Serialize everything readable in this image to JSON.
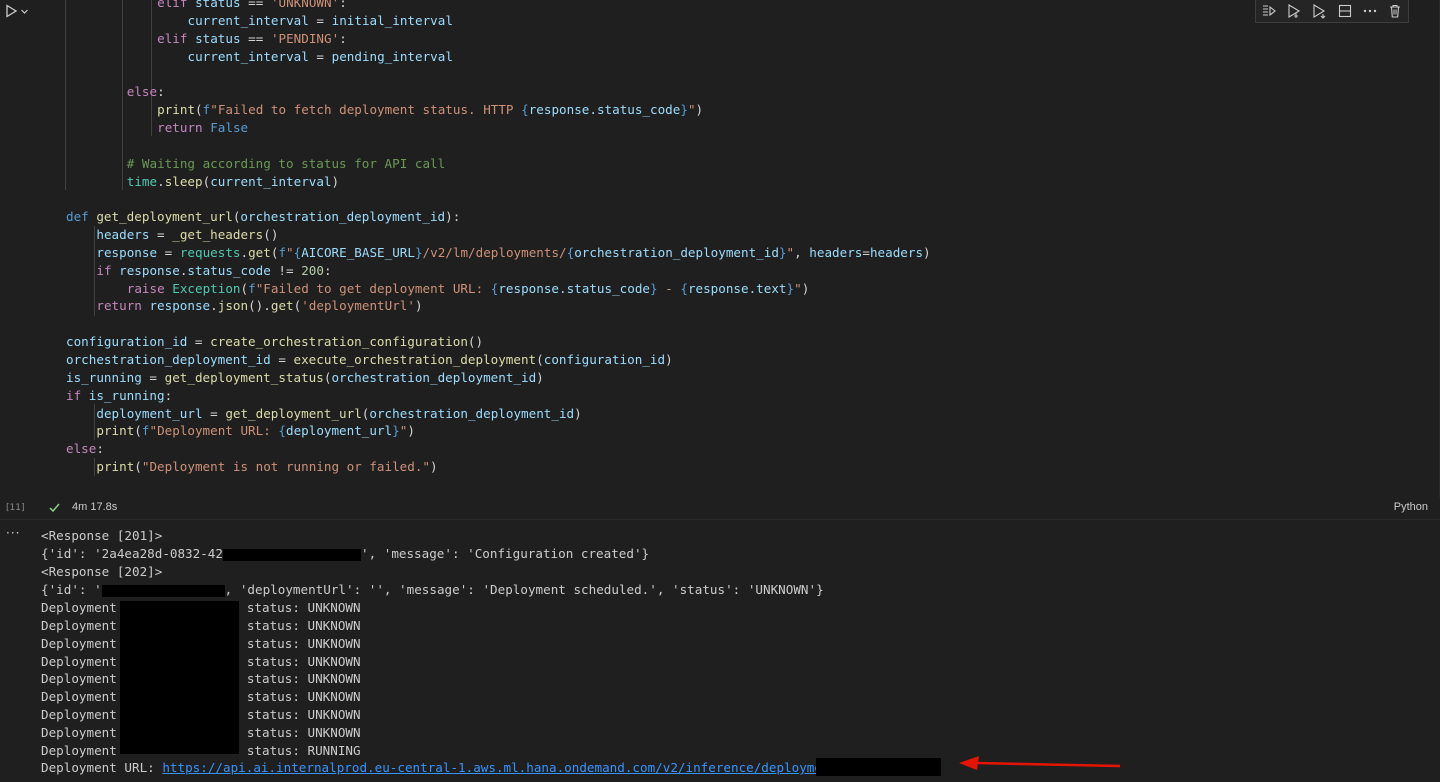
{
  "code_lines": [
    {
      "t": "            elif status == 'UNKNOWN':",
      "i": 3
    },
    {
      "t": "                current_interval = initial_interval",
      "i": 4
    },
    {
      "t": "            elif status == 'PENDING':",
      "i": 3
    },
    {
      "t": "                current_interval = pending_interval",
      "i": 4
    },
    {
      "t": "",
      "i": 0
    },
    {
      "t": "        else:",
      "i": 2
    },
    {
      "t": "            print(f\"Failed to fetch deployment status. HTTP {response.status_code}\")",
      "i": 3
    },
    {
      "t": "            return False",
      "i": 3
    },
    {
      "t": "",
      "i": 0
    },
    {
      "t": "        # Waiting according to status for API call",
      "i": 2
    },
    {
      "t": "        time.sleep(current_interval)",
      "i": 2
    },
    {
      "t": "",
      "i": 0
    },
    {
      "t": "def get_deployment_url(orchestration_deployment_id):",
      "i": 0
    },
    {
      "t": "    headers = _get_headers()",
      "i": 1
    },
    {
      "t": "    response = requests.get(f\"{AICORE_BASE_URL}/v2/lm/deployments/{orchestration_deployment_id}\", headers=headers)",
      "i": 1
    },
    {
      "t": "    if response.status_code != 200:",
      "i": 1
    },
    {
      "t": "        raise Exception(f\"Failed to get deployment URL: {response.status_code} - {response.text}\")",
      "i": 2
    },
    {
      "t": "    return response.json().get('deploymentUrl')",
      "i": 1
    },
    {
      "t": "",
      "i": 0
    },
    {
      "t": "configuration_id = create_orchestration_configuration()",
      "i": 0
    },
    {
      "t": "orchestration_deployment_id = execute_orchestration_deployment(configuration_id)",
      "i": 0
    },
    {
      "t": "is_running = get_deployment_status(orchestration_deployment_id)",
      "i": 0
    },
    {
      "t": "if is_running:",
      "i": 0
    },
    {
      "t": "    deployment_url = get_deployment_url(orchestration_deployment_id)",
      "i": 1
    },
    {
      "t": "    print(f\"Deployment URL: {deployment_url}\")",
      "i": 1
    },
    {
      "t": "else:",
      "i": 0
    },
    {
      "t": "    print(\"Deployment is not running or failed.\")",
      "i": 1
    }
  ],
  "cell": {
    "execution_count": "[11]",
    "duration": "4m 17.8s",
    "language": "Python"
  },
  "output_lines": [
    "<Response [201]>",
    "{'id': '2a4ea28d-0832-42",
    "', 'message': 'Configuration created'}",
    "<Response [202]>",
    "{'id': '",
    ", 'deploymentUrl': '', 'message': 'Deployment scheduled.', 'status': 'UNKNOWN'}",
    "Deployment",
    "status: UNKNOWN",
    "status: RUNNING",
    "Deployment URL: ",
    "https://api.ai.internalprod.eu-central-1.aws.ml.hana.ondemand.com/v2/inference/deployments/"
  ],
  "deployment_statuses": [
    "UNKNOWN",
    "UNKNOWN",
    "UNKNOWN",
    "UNKNOWN",
    "UNKNOWN",
    "UNKNOWN",
    "UNKNOWN",
    "UNKNOWN",
    "RUNNING"
  ],
  "icons": {
    "run": "run-cell-icon",
    "toolbar": [
      "run-above-icon",
      "run-by-line-icon",
      "run-below-icon",
      "split-cell-icon",
      "more-actions-icon",
      "delete-cell-icon"
    ],
    "annotation": "red-arrow-icon"
  },
  "colors": {
    "background": "#1f1f1f",
    "keyword": "#569cd6",
    "control": "#c586c0",
    "function": "#dcdcaa",
    "variable": "#9cdcfe",
    "string": "#ce9178",
    "comment": "#6a9955",
    "success": "#89d185",
    "link": "#3794ff",
    "arrow": "#e51400"
  }
}
